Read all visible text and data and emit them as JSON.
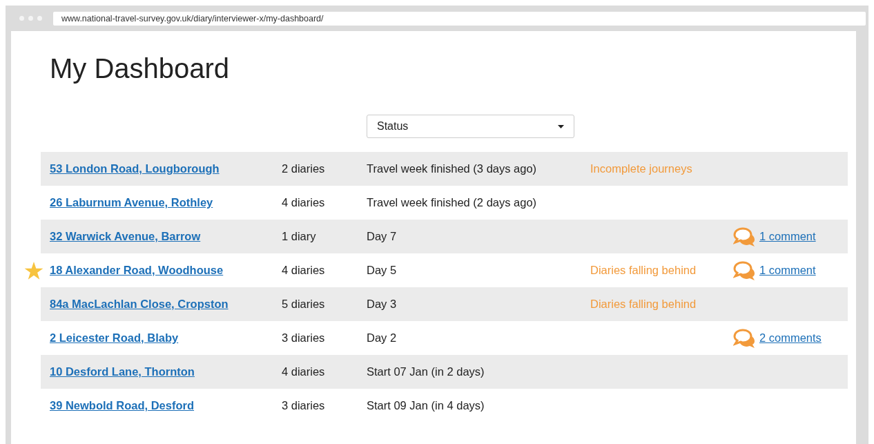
{
  "browser": {
    "url": "www.national-travel-survey.gov.uk/diary/interviewer-x/my-dashboard/"
  },
  "title": "My Dashboard",
  "status_filter": {
    "value": "Status"
  },
  "households": [
    {
      "address": "53 London Road, Lougborough",
      "diaries": "2 diaries",
      "status": "Travel week finished (3 days ago)",
      "alert": "Incomplete journeys",
      "starred": false
    },
    {
      "address": "26 Laburnum Avenue, Rothley",
      "diaries": "4 diaries",
      "status": "Travel week finished (2 days ago)",
      "starred": false
    },
    {
      "address": "32 Warwick Avenue, Barrow",
      "diaries": "1 diary",
      "status": "Day 7",
      "comments": "1 comment",
      "starred": false
    },
    {
      "address": "18 Alexander Road, Woodhouse",
      "diaries": "4 diaries",
      "status": "Day 5",
      "alert": "Diaries falling behind",
      "comments": "1 comment",
      "starred": true
    },
    {
      "address": "84a MacLachlan Close, Cropston",
      "diaries": "5 diaries",
      "status": "Day 3",
      "alert": "Diaries falling behind",
      "starred": false
    },
    {
      "address": "2 Leicester Road, Blaby",
      "diaries": "3 diaries",
      "status": "Day 2",
      "comments": "2 comments",
      "starred": false
    },
    {
      "address": "10 Desford Lane, Thornton",
      "diaries": "4 diaries",
      "status": "Start 07 Jan (in 2 days)",
      "starred": false
    },
    {
      "address": "39 Newbold Road, Desford",
      "diaries": "3 diaries",
      "status": "Start 09 Jan (in 4 days)",
      "starred": false
    }
  ]
}
